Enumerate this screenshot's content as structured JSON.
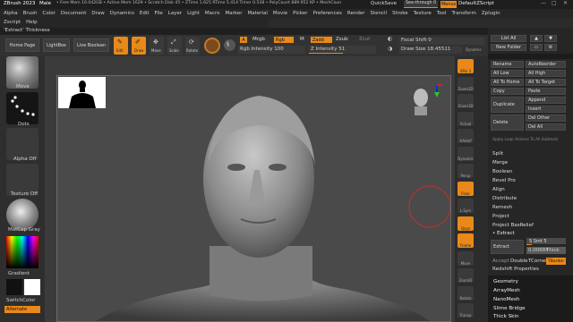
{
  "titlebar": {
    "app": "ZBrush 2023",
    "model": "Male",
    "stats": "• Free Mem 10.042GB • Active Mem 1629 • Scratch Disk 45 • ZTime 1.625 RTime 5.414 Timer 0.538 • PolyCount 889.952 KP • MeshCoun",
    "quicksave": "QuickSave",
    "seethrough": "See-through 0",
    "menus": "Menus",
    "script": "DefaultZScript"
  },
  "menu": [
    "Alpha",
    "Brush",
    "Color",
    "Document",
    "Draw",
    "Dynamics",
    "Edit",
    "File",
    "Layer",
    "Light",
    "Macro",
    "Marker",
    "Material",
    "Movie",
    "Picker",
    "Preferences",
    "Render",
    "Stencil",
    "Stroke",
    "Texture",
    "Tool",
    "Transform",
    "Zplugin"
  ],
  "menu2": [
    "Zscript",
    "Help"
  ],
  "tip": "'Extract' Thickness",
  "toolbar": {
    "home": "Home Page",
    "lightbox": "LightBox",
    "liveboolean": "Live Boolean",
    "edit": "Edit",
    "draw": "Draw",
    "move": "Move",
    "scale": "Scale",
    "rotate": "Rotate",
    "a": "A",
    "mrgb": "Mrgb",
    "rgb": "Rgb",
    "m": "M",
    "zadd": "Zadd",
    "zsub": "Zsub",
    "zcut": "Zcut",
    "rgb_intensity": "Rgb Intensity 100",
    "z_intensity": "Z Intensity 51",
    "focal_shift": "Focal Shift 0",
    "draw_size": "Draw Size 18.45511",
    "dynamic": "Dynamic"
  },
  "left": {
    "brush": "Move",
    "stroke": "Dots",
    "alpha": "Alpha Off",
    "texture": "Texture Off",
    "material": "MatCap Gray",
    "gradient": "Gradient",
    "switchcolor": "SwitchColor",
    "alternate": "Alternate"
  },
  "right_shelf": [
    "SPix 3",
    "Zoom2D",
    "Zoom3D",
    "Actual",
    "AAHalf",
    "Dynamic",
    "Persp",
    "Floor",
    "L.Sym",
    "Qxyz",
    "Frame",
    "Move",
    "ZoomD",
    "Rotate",
    "Transp"
  ],
  "tray": {
    "listall": "List All",
    "newfolder": "New Folder",
    "rename": "Rename",
    "autoreorder": "AutoReorder",
    "alllow": "All Low",
    "allhigh": "All High",
    "tohome": "All To Home",
    "totarget": "All To Target",
    "copy": "Copy",
    "paste": "Paste",
    "duplicate": "Duplicate",
    "append": "Append",
    "insert": "Insert",
    "delete": "Delete",
    "delother": "Del Other",
    "delall": "Del All",
    "applyloop": "Apply Loop Actions To All Subtools",
    "split": "Split",
    "merge": "Merge",
    "boolean": "Boolean",
    "bevelpro": "Bevel Pro",
    "align": "Align",
    "distribute": "Distribute",
    "remesh": "Remesh",
    "project": "Project",
    "projectbas": "Project BasRelief",
    "extract_header": "• Extract",
    "extract": "Extract",
    "ssmt": "S Smt 5",
    "thick": "Thick",
    "thick_val": "0.00684",
    "tcorner": "TCorner",
    "tborder": "TBorder",
    "accept": "Accept",
    "double": "Double",
    "redshift": "Redshift Properties",
    "geometry": "Geometry",
    "arraymesh": "ArrayMesh",
    "nanomesh": "NanoMesh",
    "slimebridge": "Slime Bridge",
    "thickskin": "Thick Skin"
  },
  "colors": {
    "accent": "#e8891a",
    "panel": "#2b2b2b",
    "canvas": "#4a4a4a"
  }
}
